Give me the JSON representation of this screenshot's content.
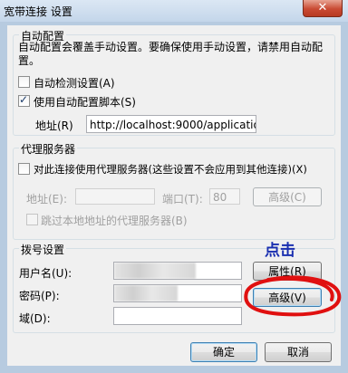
{
  "window": {
    "title": "宽带连接 设置",
    "close_glyph": "✕"
  },
  "auto_config": {
    "legend": "自动配置",
    "description": "自动配置会覆盖手动设置。要确保使用手动设置，请禁用自动配置。",
    "detect_label": "自动检测设置(A)",
    "detect_checked": false,
    "script_label": "使用自动配置脚本(S)",
    "script_checked": true,
    "address_label": "地址(R)",
    "address_value": "http://localhost:9000/applicatio"
  },
  "proxy": {
    "legend": "代理服务器",
    "use_proxy_label": "对此连接使用代理服务器(这些设置不会应用到其他连接)(X)",
    "use_proxy_checked": false,
    "address_label": "地址(E):",
    "address_value": "",
    "port_label": "端口(T):",
    "port_value": "80",
    "advanced_label": "高级(C)",
    "bypass_label": "跳过本地地址的代理服务器(B)",
    "bypass_checked": false
  },
  "dialup": {
    "legend": "拨号设置",
    "username_label": "用户名(U):",
    "password_label": "密码(P):",
    "domain_label": "域(D):",
    "properties_label": "属性(R)",
    "advanced_label": "高级(V)"
  },
  "annotation": {
    "text": "点击",
    "color": "#e01010"
  },
  "footer": {
    "ok_label": "确定",
    "cancel_label": "取消"
  }
}
